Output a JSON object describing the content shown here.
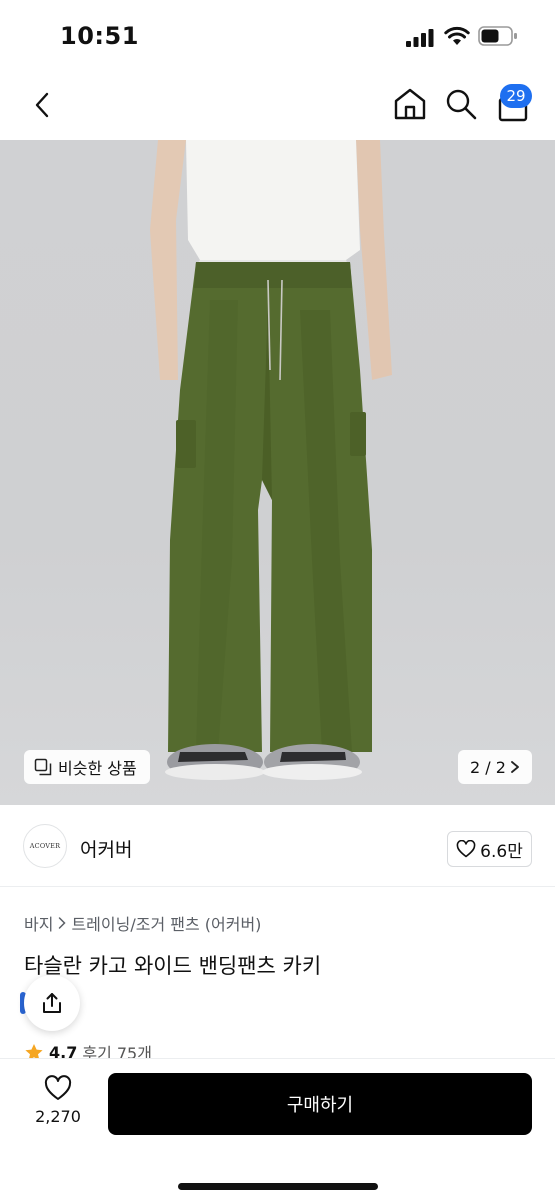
{
  "status_bar": {
    "time": "10:51",
    "icons": [
      "cellular-signal-icon",
      "wifi-icon",
      "battery-icon"
    ]
  },
  "nav": {
    "icons": [
      "back-chevron-icon",
      "home-icon",
      "search-icon",
      "cart-icon"
    ],
    "cart_badge": "29",
    "accent_color": "#1e6ff0"
  },
  "gallery": {
    "similar_label": "비슷한 상품",
    "pager": "2 / 2"
  },
  "brand": {
    "logo_text": "ACOVER",
    "name": "어커버",
    "likes": "6.6만"
  },
  "product": {
    "breadcrumb": [
      "바지",
      "트레이닝/조거 팬츠 (어커버)"
    ],
    "title": "타슬란 카고 와이드 밴딩팬츠 카키",
    "rating": "4.7",
    "reviews_label": "후기 75개"
  },
  "bottom": {
    "wish_count": "2,270",
    "buy_label": "구매하기"
  }
}
